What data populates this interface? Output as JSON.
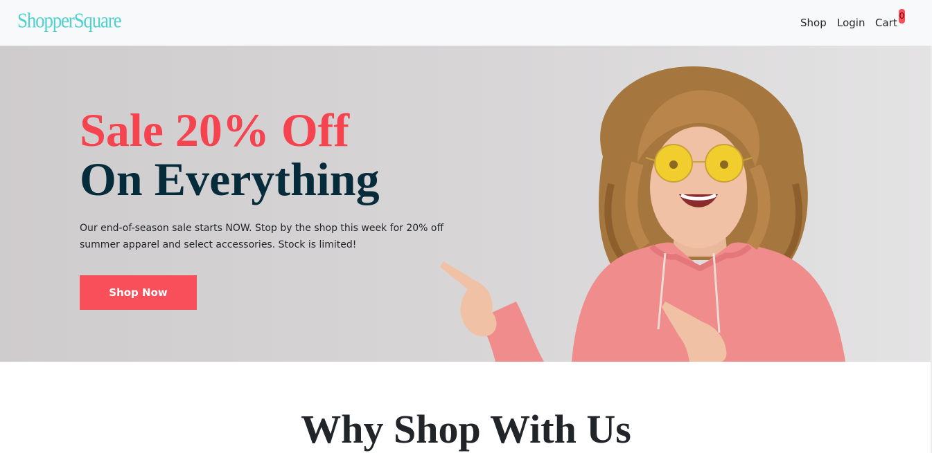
{
  "navbar": {
    "brand": "ShopperSquare",
    "links": [
      "Shop",
      "Login",
      "Cart"
    ],
    "cart_count": "0"
  },
  "hero": {
    "title_line1": "Sale 20% Off",
    "title_line2": "On Everything",
    "description": "Our end-of-season sale starts NOW. Stop by the shop this week for 20% off summer apparel and select accessories. Stock is limited!",
    "button_label": "Shop Now",
    "image": "smiling-woman-pink-hoodie-yellow-sunglasses-pointing"
  },
  "section": {
    "title": "Why Shop With Us"
  },
  "colors": {
    "brand": "#4fd1cf",
    "accent": "#f84f5a",
    "dark": "#062c3b"
  }
}
